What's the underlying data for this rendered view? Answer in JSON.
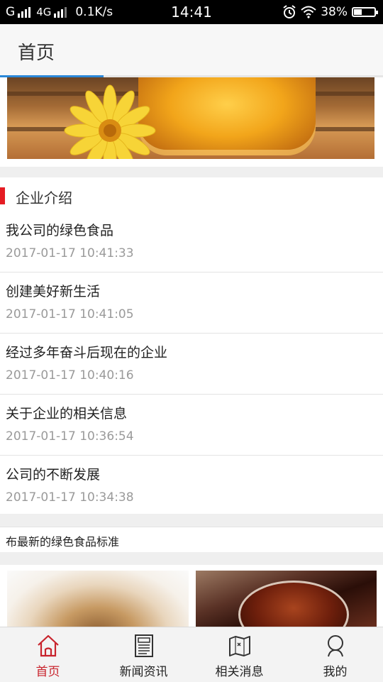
{
  "status_bar": {
    "carrier1": "G",
    "network": "4G",
    "speed": "0.1K/s",
    "time": "14:41",
    "battery": "38%",
    "battery_level": 0.38,
    "icons": [
      "signal-icon",
      "alarm-icon",
      "wifi-icon",
      "battery-icon"
    ]
  },
  "header": {
    "title": "首页",
    "progress": 0.27,
    "accent_color": "#2b88d8"
  },
  "section": {
    "title": "企业介绍",
    "marker_color": "#e51c23"
  },
  "news": [
    {
      "title": "我公司的绿色食品",
      "date": "2017-01-17 10:41:33"
    },
    {
      "title": "创建美好新生活",
      "date": "2017-01-17 10:41:05"
    },
    {
      "title": "经过多年奋斗后现在的企业",
      "date": "2017-01-17 10:40:16"
    },
    {
      "title": "关于企业的相关信息",
      "date": "2017-01-17 10:36:54"
    },
    {
      "title": "公司的不断发展",
      "date": "2017-01-17 10:34:38"
    }
  ],
  "marquee": {
    "text": "布最新的绿色食品标准"
  },
  "tabs": [
    {
      "label": "首页",
      "icon": "home-icon",
      "active": true
    },
    {
      "label": "新闻资讯",
      "icon": "newspaper-icon",
      "active": false
    },
    {
      "label": "相关消息",
      "icon": "map-icon",
      "active": false
    },
    {
      "label": "我的",
      "icon": "user-icon",
      "active": false
    }
  ],
  "colors": {
    "active_tab": "#c8232c"
  }
}
